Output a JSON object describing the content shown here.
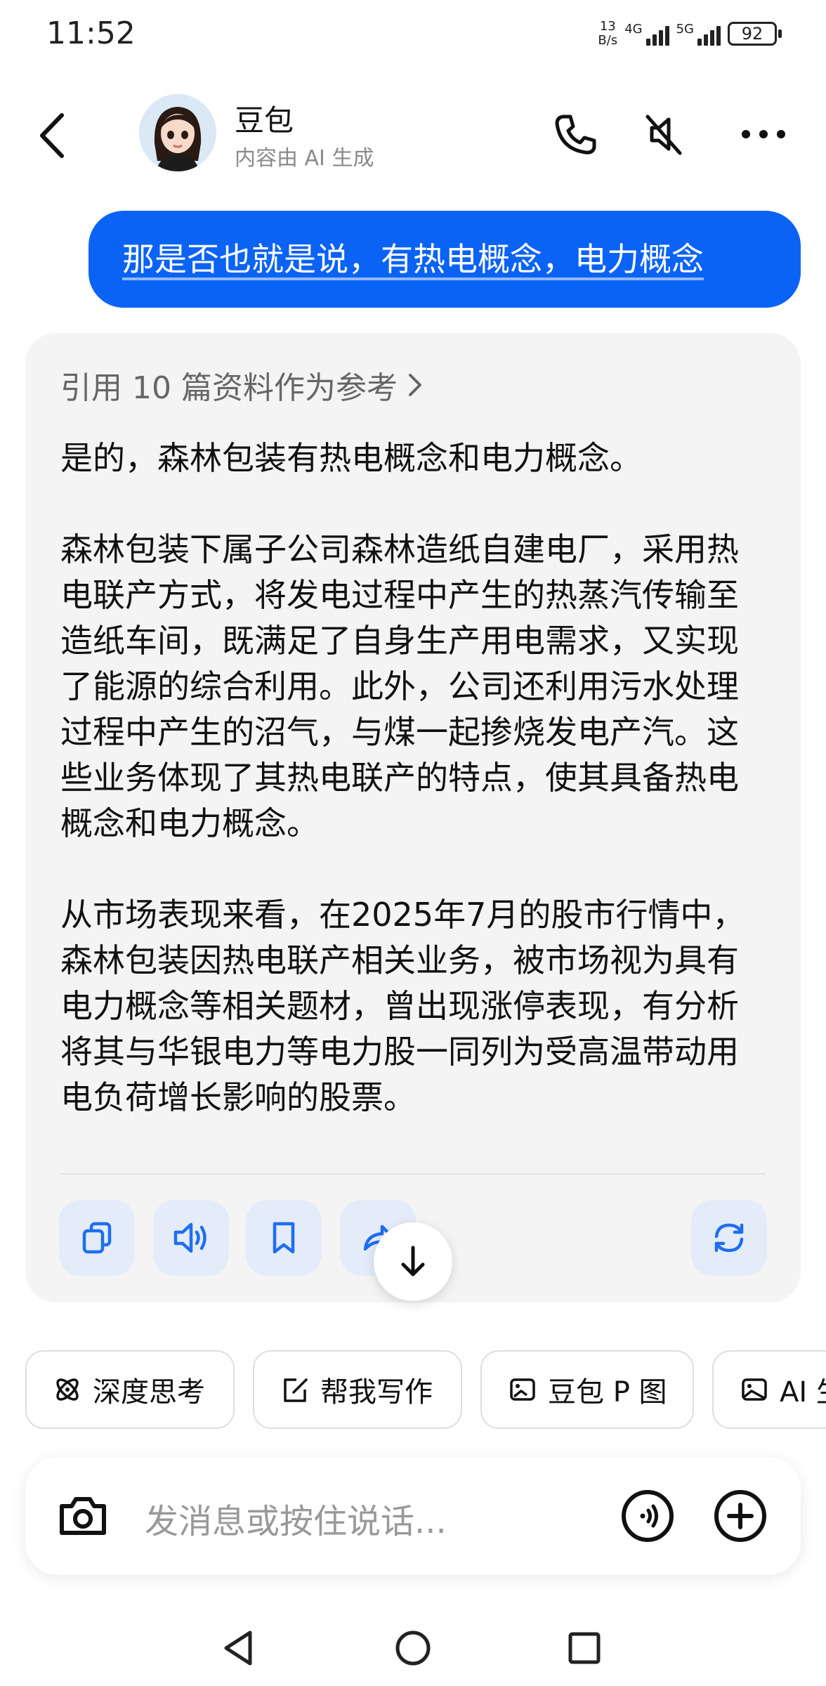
{
  "status_bar": {
    "time": "11:52",
    "net_speed_value": "13",
    "net_speed_unit": "B/s",
    "sim1_label": "4G",
    "sim2_label": "5G",
    "battery": "92"
  },
  "header": {
    "name": "豆包",
    "subtitle": "内容由 AI 生成",
    "icons": [
      "back-icon",
      "phone-icon",
      "speaker-muted-icon",
      "more-icon"
    ]
  },
  "user_message": "那是否也就是说，有热电概念，电力概念",
  "ai_message": {
    "references": "引用 10 篇资料作为参考",
    "paragraphs": [
      "是的，森林包装有热电概念和电力概念。",
      "森林包装下属子公司森林造纸自建电厂，采用热电联产方式，将发电过程中产生的热蒸汽传输至造纸车间，既满足了自身生产用电需求，又实现了能源的综合利用。此外，公司还利用污水处理过程中产生的沼气，与煤一起掺烧发电产汽。这些业务体现了其热电联产的特点，使其具备热电概念和电力概念。",
      "从市场表现来看，在2025年7月的股市行情中，森林包装因热电联产相关业务，被市场视为具有电力概念等相关题材，曾出现涨停表现，有分析将其与华银电力等电力股一同列为受高温带动用电负荷增长影响的股票。"
    ],
    "actions": [
      "copy-icon",
      "speaker-icon",
      "bookmark-icon",
      "share-icon",
      "regenerate-icon"
    ]
  },
  "chips": [
    {
      "label": "深度思考",
      "icon": "atom-icon"
    },
    {
      "label": "帮我写作",
      "icon": "edit-icon"
    },
    {
      "label": "豆包 P 图",
      "icon": "image-edit-icon"
    },
    {
      "label": "AI 生",
      "icon": "image-icon"
    }
  ],
  "input": {
    "placeholder": "发消息或按住说话..."
  },
  "colors": {
    "accent": "#0a63f5",
    "card_bg": "#f4f4f5",
    "action_bg": "#e4ecf9",
    "action_icon": "#1f6ef0"
  }
}
